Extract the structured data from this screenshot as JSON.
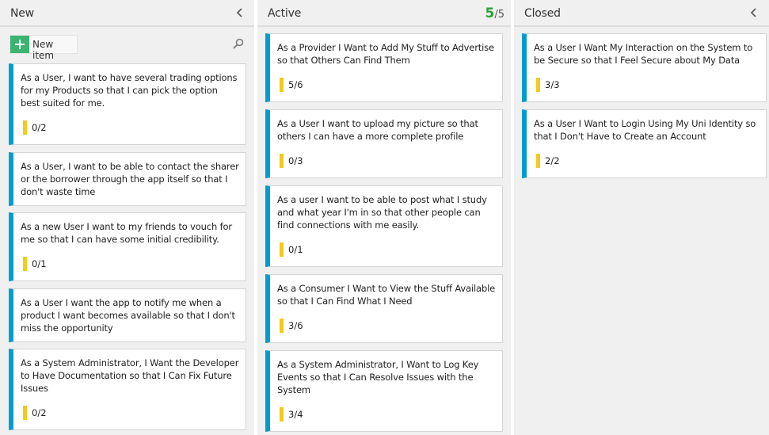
{
  "columns": [
    {
      "title": "New",
      "new_item_label": "New item",
      "cards": [
        {
          "text": "As a User, I want to have several trading options for my Products so that I can pick the option best suited for me.",
          "tasks": "0/2"
        },
        {
          "text": "As a User, I want to be able to contact the sharer or the borrower through the app itself so that I don't waste time",
          "tasks": ""
        },
        {
          "text": "As a new User I want to my friends to vouch for me so that I can have some initial credibility.",
          "tasks": "0/1"
        },
        {
          "text": "As a User I want the app to notify me when a product I want becomes available so that I don't miss the opportunity",
          "tasks": ""
        },
        {
          "text": "As a System Administrator, I Want the Developer to Have Documentation so that I Can Fix Future Issues",
          "tasks": "0/2"
        }
      ]
    },
    {
      "title": "Active",
      "wip_current": "5",
      "wip_limit": "/5",
      "cards": [
        {
          "text": "As a Provider I Want to Add My Stuff to Advertise so that Others Can Find Them",
          "tasks": "5/6"
        },
        {
          "text": "As a User I want to upload my picture so that others I can have a more complete profile",
          "tasks": "0/3"
        },
        {
          "text": "As a user I want to be able to post what I study and what year I'm in so that other people can find connections with me easily.",
          "tasks": "0/1"
        },
        {
          "text": "As a Consumer I Want to View the Stuff Available so that I Can Find What I Need",
          "tasks": "3/6"
        },
        {
          "text": "As a System Administrator, I Want to Log Key Events so that I Can Resolve Issues with the System",
          "tasks": "3/4"
        }
      ]
    },
    {
      "title": "Closed",
      "cards": [
        {
          "text": "As a User I Want My Interaction on the System to be Secure so that I Feel Secure about My Data",
          "tasks": "3/3"
        },
        {
          "text": "As a User I Want to Login Using My Uni Identity so that I Don't Have to Create an Account",
          "tasks": "2/2"
        }
      ]
    }
  ],
  "colors": {
    "card_accent": "#009ccc",
    "task_bar": "#f2cb1d",
    "wip_ok": "#2e9e3a",
    "new_item_plus": "#3cb371"
  },
  "icons": [
    "plus-icon",
    "search-icon",
    "chevron-left-icon"
  ]
}
